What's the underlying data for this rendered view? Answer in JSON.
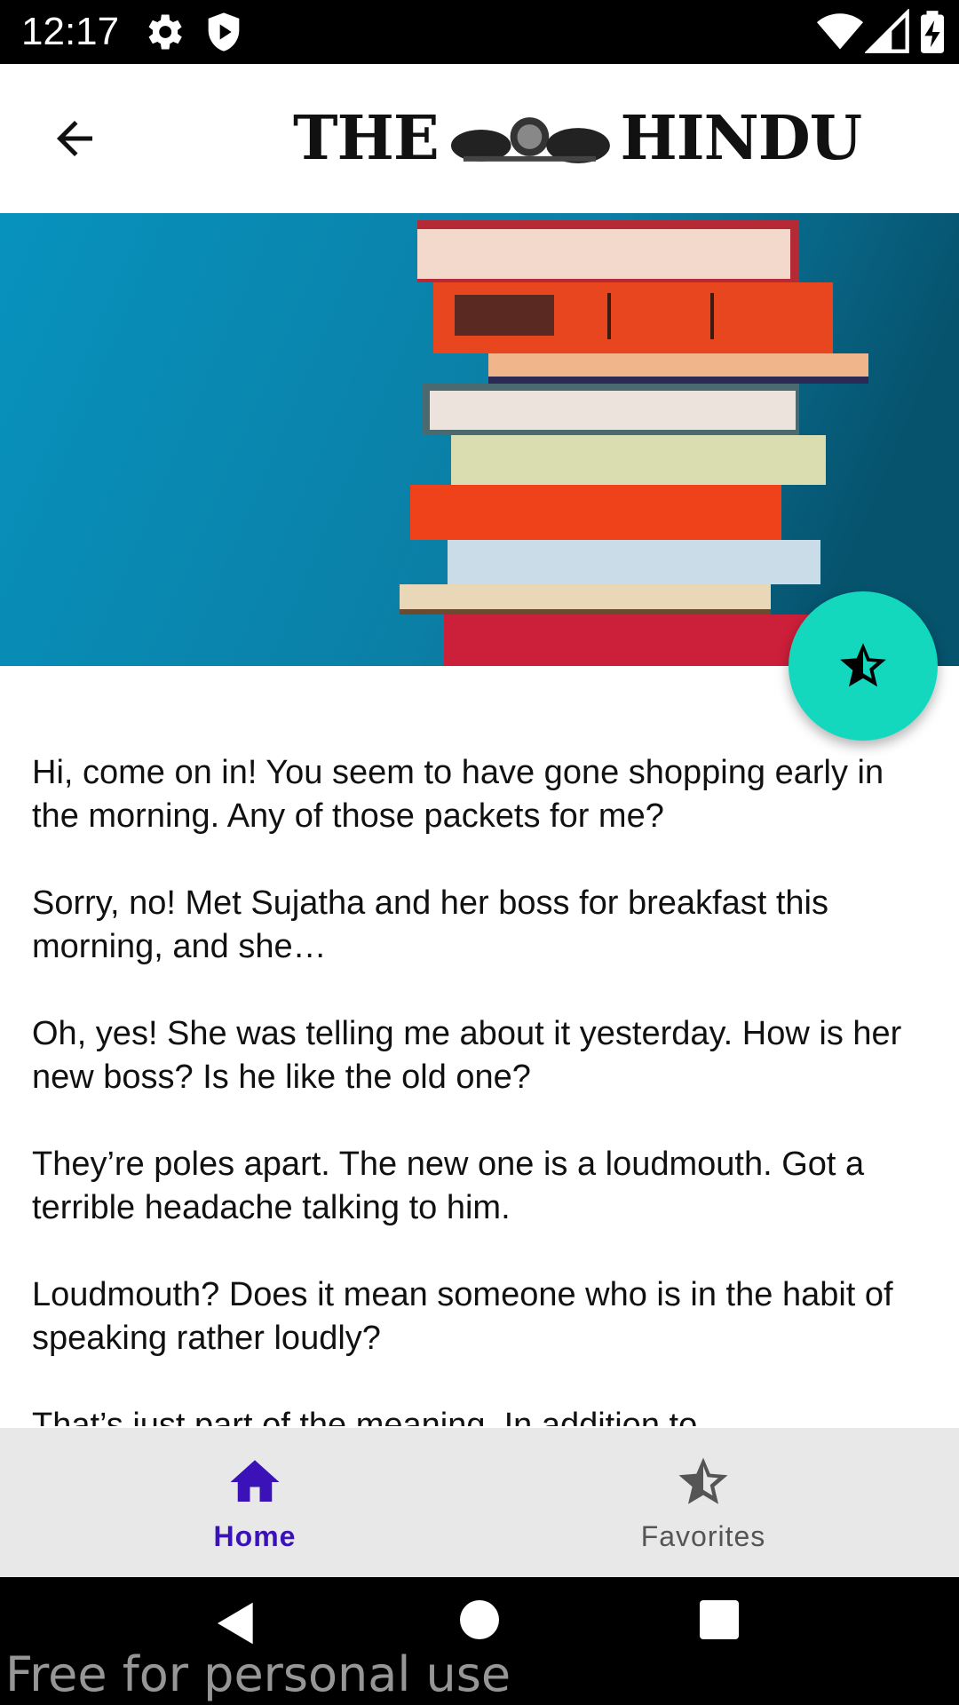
{
  "status_bar": {
    "time": "12:17",
    "icons": [
      "settings-icon",
      "shield-icon",
      "wifi-icon",
      "signal-icon",
      "battery-charging-icon"
    ]
  },
  "app_bar": {
    "back_icon": "arrow-back-icon",
    "logo_text_left": "THE",
    "logo_text_right": "HINDU"
  },
  "hero": {
    "image": "stack-of-books-image",
    "background_color": "#0a8fb8"
  },
  "fab": {
    "icon": "star-outline-filled-icon",
    "color": "#14d8be"
  },
  "article": {
    "paragraphs": [
      "Hi, come on in! You seem to have gone shopping early in the morning. Any of those packets for me?",
      "Sorry, no! Met Sujatha and her boss for breakfast this morning, and she…",
      "Oh, yes! She was telling me about it yesterday. How is her new boss? Is he like the old one?",
      "They’re poles apart. The new one is a loudmouth. Got a terrible headache talking to him.",
      "Loudmouth? Does it mean someone who is in the habit of speaking rather loudly?",
      "That’s just part of the meaning. In addition to"
    ]
  },
  "bottom_nav": {
    "items": [
      {
        "label": "Home",
        "icon": "home-icon",
        "selected": true
      },
      {
        "label": "Favorites",
        "icon": "star-icon",
        "selected": false
      }
    ],
    "accent": "#3a12b8"
  },
  "system_nav": {
    "icons": [
      "nav-back-icon",
      "nav-home-icon",
      "nav-recents-icon"
    ]
  },
  "watermark": "Free for personal use"
}
